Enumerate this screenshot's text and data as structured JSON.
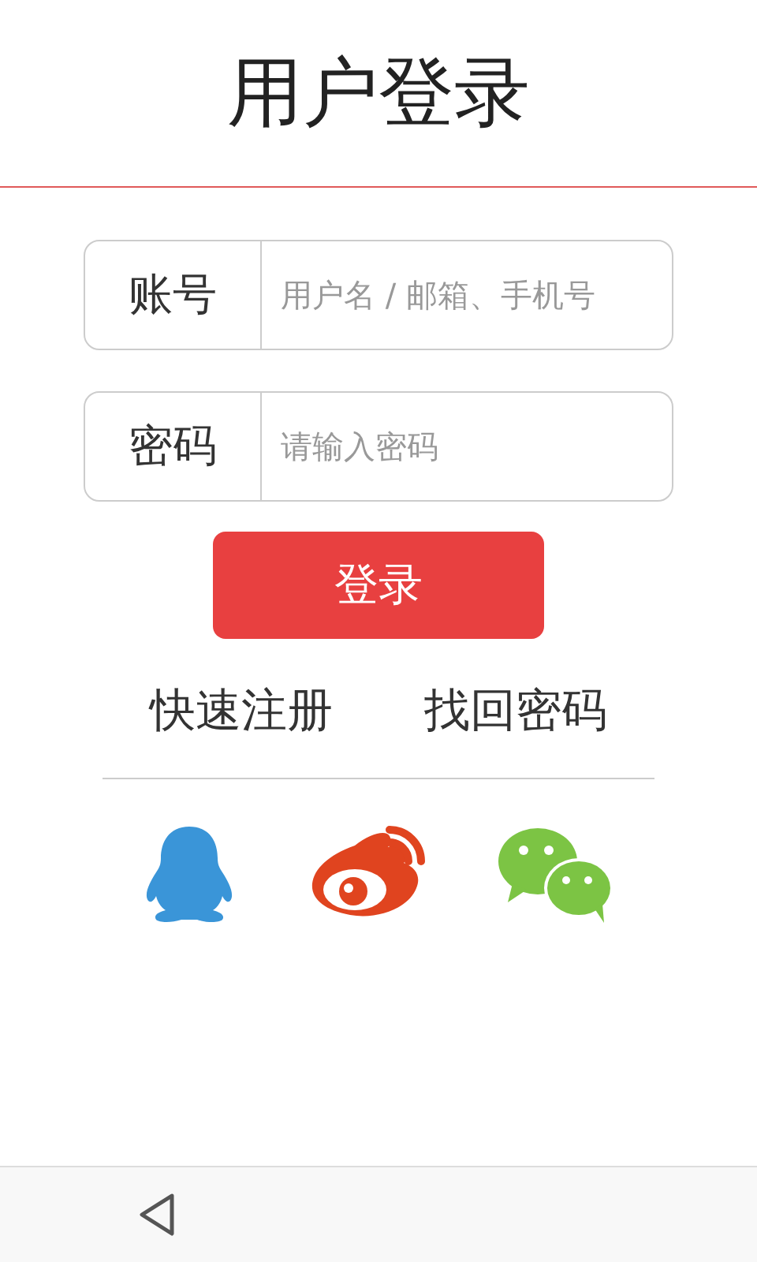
{
  "header": {
    "title": "用户登录"
  },
  "fields": [
    {
      "label": "账号",
      "placeholder": "用户名 / 邮箱、手机号"
    },
    {
      "label": "密码",
      "placeholder": "请输入密码"
    }
  ],
  "login_button": "登录",
  "links": [
    "快速注册",
    "找回密码"
  ]
}
